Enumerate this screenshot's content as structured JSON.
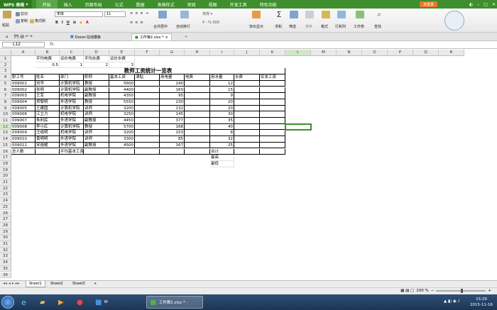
{
  "app": {
    "name": "WPS 表格",
    "login": "未登录"
  },
  "menu": [
    "开始",
    "插入",
    "页面布局",
    "公式",
    "数据",
    "表格样式",
    "审阅",
    "视图",
    "开发工具",
    "特色功能"
  ],
  "ribbon": {
    "paste": "粘贴",
    "cut": "剪切",
    "copy": "复制",
    "format_painter": "格式刷",
    "font_name": "宋体",
    "font_size": "11",
    "merge": "合并居中",
    "wrap": "自动换行",
    "highlight": "突出显示",
    "sum": "求和",
    "filter": "筛选",
    "sort": "排序",
    "format": "格式",
    "rowcol": "行和列",
    "sheet": "工作表",
    "find": "查找"
  },
  "doc_tabs": [
    {
      "label": "Docer-在线模板"
    },
    {
      "label": "工作簿2.xlsx *"
    }
  ],
  "formula_bar": {
    "cell_ref": "L12",
    "fx": "fx",
    "value": ""
  },
  "columns": [
    "A",
    "B",
    "C",
    "D",
    "E",
    "F",
    "G",
    "H",
    "I",
    "J",
    "K",
    "L",
    "M",
    "N",
    "O",
    "P",
    "Q",
    "R"
  ],
  "rows": [
    "1",
    "2",
    "3",
    "4",
    "5",
    "6",
    "7",
    "8",
    "9",
    "10",
    "11",
    "12",
    "13",
    "14",
    "15",
    "16",
    "17",
    "18",
    "19",
    "20",
    "21",
    "22",
    "23",
    "24",
    "25",
    "26",
    "27",
    "28",
    "29",
    "30",
    "31",
    "32",
    "33",
    "34",
    "35",
    "36"
  ],
  "sheet": {
    "r1": {
      "B": "平均电费",
      "C": "议价电费",
      "D": "平均水费",
      "E": "议价水费"
    },
    "r2": {
      "B": "0.5",
      "C": "1",
      "D": "2",
      "E": "3"
    },
    "title": "教师工资统计一览表",
    "headers": [
      "职工号",
      "姓名",
      "部门",
      "职称",
      "基本工资",
      "津贴",
      "用电量",
      "电费",
      "用水量",
      "水费",
      "实发工资"
    ],
    "records": [
      [
        "009001",
        "刘华",
        "计算机学院",
        "教授",
        "5600",
        "",
        "240",
        "",
        "12",
        "",
        ""
      ],
      [
        "009002",
        "张明",
        "计算机学院",
        "副教授",
        "4400",
        "",
        "160",
        "",
        "15",
        "",
        ""
      ],
      [
        "009003",
        "王军",
        "机电学院",
        "副教授",
        "4350",
        "",
        "95",
        "",
        "9",
        "",
        ""
      ],
      [
        "009004",
        "郑黎明",
        "外语学院",
        "教授",
        "5550",
        "",
        "230",
        "",
        "20",
        "",
        ""
      ],
      [
        "009005",
        "王建国",
        "计算机学院",
        "讲师",
        "3200",
        "",
        "132",
        "",
        "20",
        "",
        ""
      ],
      [
        "009006",
        "江立力",
        "机电学院",
        "讲师",
        "3250",
        "",
        "145",
        "",
        "30",
        "",
        ""
      ],
      [
        "009007",
        "朱利民",
        "外语学院",
        "副教授",
        "4450",
        "",
        "377",
        "",
        "35",
        "",
        ""
      ],
      [
        "009008",
        "李小红",
        "计算机学院",
        "教授",
        "5700",
        "",
        "168",
        "",
        "40",
        "",
        ""
      ],
      [
        "009009",
        "汪成明",
        "机电学院",
        "讲师",
        "3200",
        "",
        "153",
        "",
        "8",
        "",
        ""
      ],
      [
        "009010",
        "黄明明",
        "外语学院",
        "讲师",
        "3300",
        "",
        "85",
        "",
        "32",
        "",
        ""
      ],
      [
        "009011",
        "宋祖耀",
        "外语学院",
        "副教授",
        "4500",
        "",
        "167",
        "",
        "25",
        "",
        ""
      ]
    ],
    "r16": {
      "A": "总人数",
      "C": "平均基本工资",
      "I": "合计"
    },
    "r17": {
      "I": "最高"
    },
    "r18": {
      "I": "最低"
    }
  },
  "sheet_tabs": [
    "Sheet1",
    "Sheet2",
    "Sheet3"
  ],
  "status": {
    "zoom": "100 %"
  },
  "taskbar": {
    "items": [
      "Internet Explorer",
      "File Explorer",
      "Chrome",
      "W",
      "工作簿2.xlsx * -"
    ],
    "time": "15:29",
    "date": "2015-11-16"
  },
  "colors": {
    "accent": "#3f8f2e",
    "taskbar": "#1c3555"
  }
}
